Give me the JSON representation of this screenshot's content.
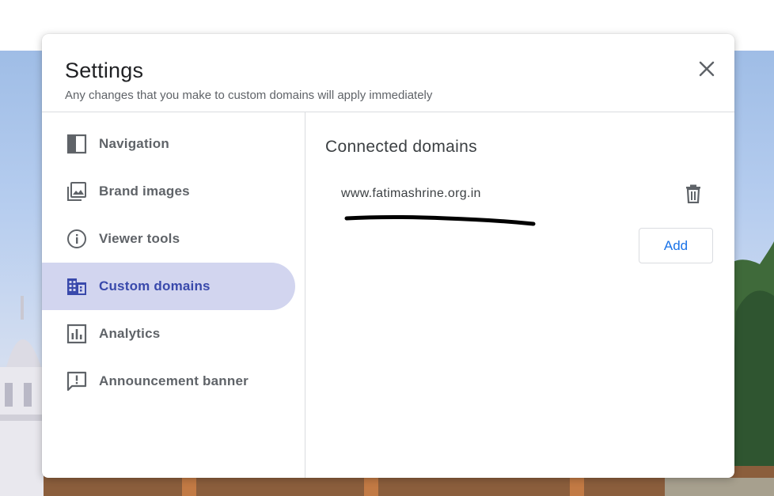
{
  "dialog": {
    "title": "Settings",
    "subtitle": "Any changes that you make to custom domains will apply immediately",
    "close_icon": "close-icon"
  },
  "sidebar": {
    "items": [
      {
        "label": "Navigation",
        "icon": "navigation-panel-icon",
        "active": false
      },
      {
        "label": "Brand images",
        "icon": "photo-library-icon",
        "active": false
      },
      {
        "label": "Viewer tools",
        "icon": "info-icon",
        "active": false
      },
      {
        "label": "Custom domains",
        "icon": "domain-building-icon",
        "active": true
      },
      {
        "label": "Analytics",
        "icon": "analytics-chart-icon",
        "active": false
      },
      {
        "label": "Announcement banner",
        "icon": "feedback-exclamation-icon",
        "active": false
      }
    ]
  },
  "main": {
    "section_title": "Connected domains",
    "domains": [
      {
        "name": "www.fatimashrine.org.in",
        "delete_icon": "trash-icon"
      }
    ],
    "add_label": "Add"
  },
  "colors": {
    "active_bg": "#d2d5ef",
    "active_text": "#3949ab",
    "accent": "#1a73e8",
    "text_secondary": "#5f6368"
  }
}
